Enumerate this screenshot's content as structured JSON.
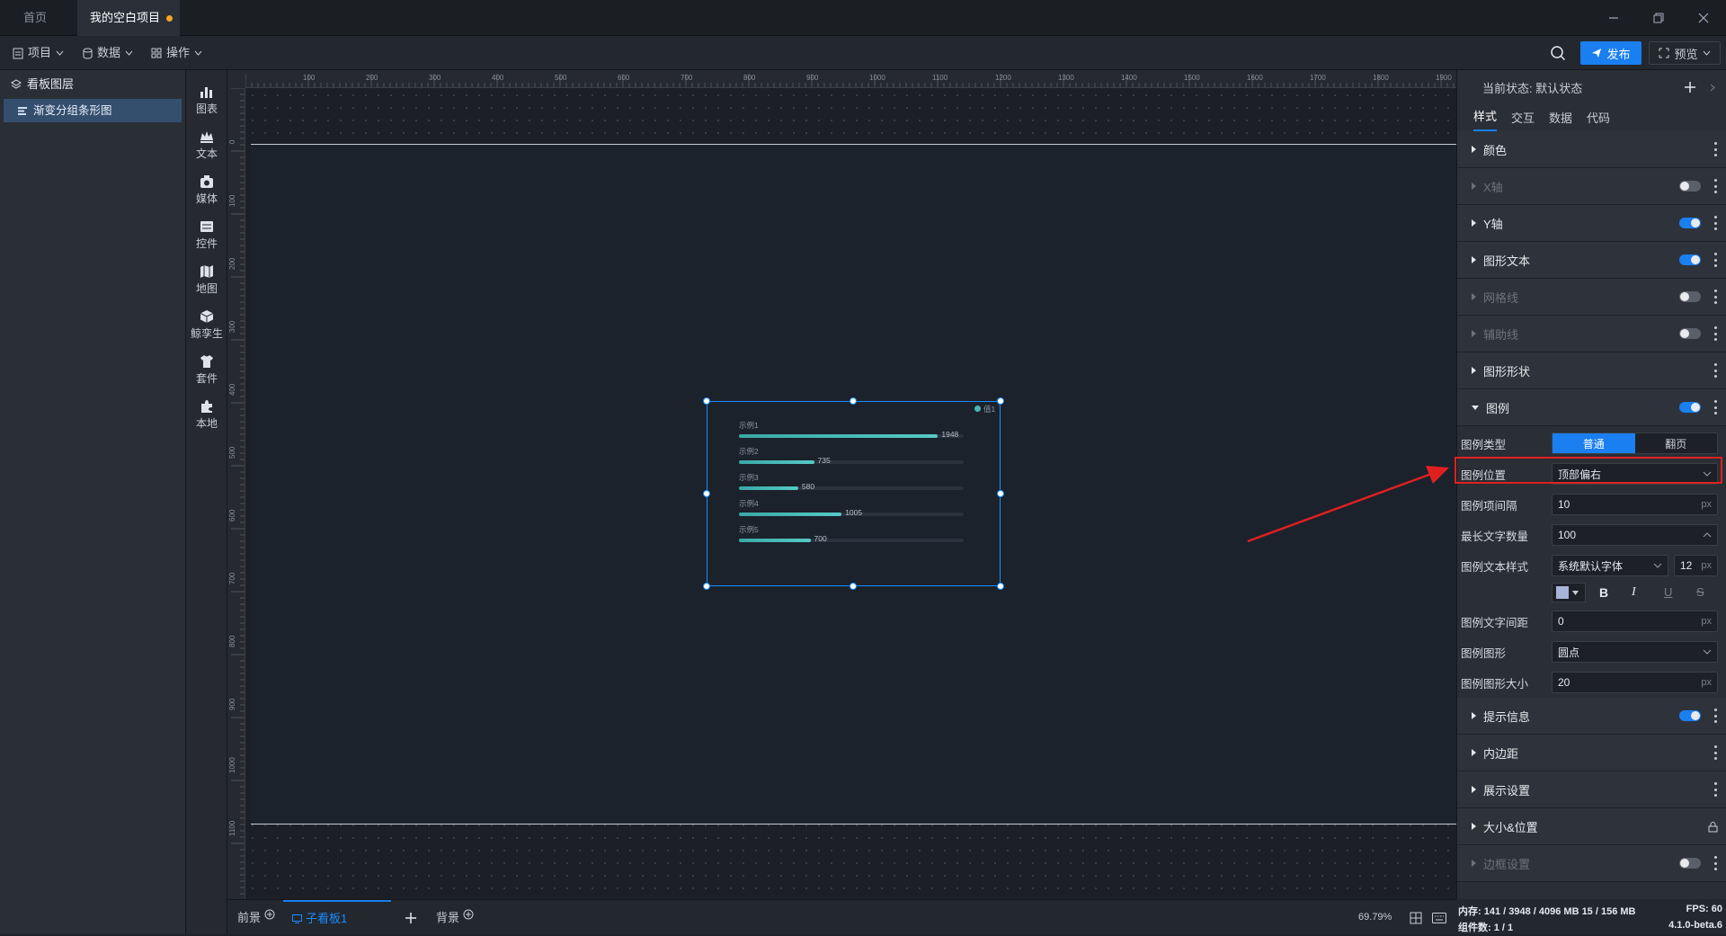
{
  "tabs": {
    "home": "首页",
    "project": "我的空白项目"
  },
  "toolbar": {
    "project": "项目",
    "data": "数据",
    "operation": "操作",
    "publish": "发布",
    "preview": "预览"
  },
  "layers": {
    "title": "看板图层",
    "item": "渐变分组条形图"
  },
  "components": [
    "图表",
    "文本",
    "媒体",
    "控件",
    "地图",
    "鲸孪生",
    "套件",
    "本地"
  ],
  "ruler": {
    "top": [
      "100",
      "200",
      "300",
      "400",
      "500",
      "600",
      "700",
      "800",
      "900",
      "1000",
      "1100",
      "1200",
      "1300",
      "1400",
      "1500",
      "1600",
      "1700",
      "1800",
      "1900"
    ],
    "left": [
      "0",
      "100",
      "200",
      "300",
      "400",
      "500",
      "600",
      "700",
      "800",
      "900",
      "1000",
      "1100"
    ]
  },
  "widget": {
    "legend": "值1",
    "items": [
      {
        "label": "示例1",
        "value": 1948
      },
      {
        "label": "示例2",
        "value": 735
      },
      {
        "label": "示例3",
        "value": 580
      },
      {
        "label": "示例4",
        "value": 1005
      },
      {
        "label": "示例5",
        "value": 700
      }
    ],
    "max": 2200
  },
  "bottom": {
    "front": "前景",
    "board": "子看板1",
    "back": "背景",
    "zoom": "69.79%"
  },
  "panel": {
    "state_label": "当前状态: 默认状态",
    "tabs": [
      "样式",
      "交互",
      "数据",
      "代码"
    ],
    "sections_top": [
      {
        "label": "颜色",
        "toggle": null,
        "disabled": false
      },
      {
        "label": "X轴",
        "toggle": false,
        "disabled": true
      },
      {
        "label": "Y轴",
        "toggle": true,
        "disabled": false
      },
      {
        "label": "图形文本",
        "toggle": true,
        "disabled": false
      },
      {
        "label": "网格线",
        "toggle": false,
        "disabled": true
      },
      {
        "label": "辅助线",
        "toggle": false,
        "disabled": true
      },
      {
        "label": "图形形状",
        "toggle": null,
        "disabled": false
      }
    ],
    "legend": {
      "title": "图例",
      "toggle": true,
      "type_label": "图例类型",
      "type_options": [
        "普通",
        "翻页"
      ],
      "position_label": "图例位置",
      "position_value": "顶部偏右",
      "spacing_label": "图例项间隔",
      "spacing_value": "10",
      "maxtext_label": "最长文字数量",
      "maxtext_value": "100",
      "textstyle_label": "图例文本样式",
      "font_value": "系统默认字体",
      "fontsize_value": "12",
      "textspacing_label": "图例文字间距",
      "textspacing_value": "0",
      "shape_label": "图例图形",
      "shape_value": "圆点",
      "shapesize_label": "图例图形大小",
      "shapesize_value": "20",
      "unit": "px"
    },
    "sections_bottom": [
      {
        "label": "提示信息",
        "toggle": true,
        "disabled": false
      },
      {
        "label": "内边距",
        "toggle": null,
        "disabled": false
      },
      {
        "label": "展示设置",
        "toggle": null,
        "disabled": false
      },
      {
        "label": "大小&位置",
        "toggle": null,
        "disabled": false,
        "lock": true
      },
      {
        "label": "边框设置",
        "toggle": false,
        "disabled": true
      }
    ]
  },
  "status": {
    "memory": "内存: 141 / 3948 / 4096 MB  15 / 156 MB",
    "fps": "FPS: 60",
    "count": "组件数: 1 / 1",
    "version": "4.1.0-beta.6"
  }
}
